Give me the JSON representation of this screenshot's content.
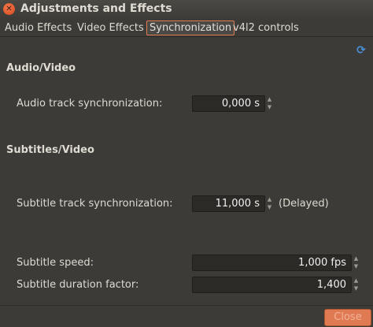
{
  "window": {
    "title": "Adjustments and Effects"
  },
  "tabs": [
    {
      "label": "Audio Effects"
    },
    {
      "label": "Video Effects"
    },
    {
      "label": "Synchronization"
    },
    {
      "label": "v4l2 controls"
    }
  ],
  "sections": {
    "audio_video": "Audio/Video",
    "subtitles_video": "Subtitles/Video"
  },
  "audio_track_sync": {
    "label": "Audio track synchronization:",
    "value": "0,000 s"
  },
  "subtitle_track_sync": {
    "label": "Subtitle track synchronization:",
    "value": "11,000 s",
    "status": "(Delayed)"
  },
  "subtitle_speed": {
    "label": "Subtitle speed:",
    "value": "1,000 fps"
  },
  "subtitle_duration": {
    "label": "Subtitle duration factor:",
    "value": "1,400"
  },
  "buttons": {
    "close": "Close"
  },
  "icons": {
    "window_close": "close-icon",
    "refresh": "refresh-icon"
  },
  "colors": {
    "accent": "#e07a52",
    "refresh": "#4a90d9",
    "background": "#3c3b37"
  }
}
